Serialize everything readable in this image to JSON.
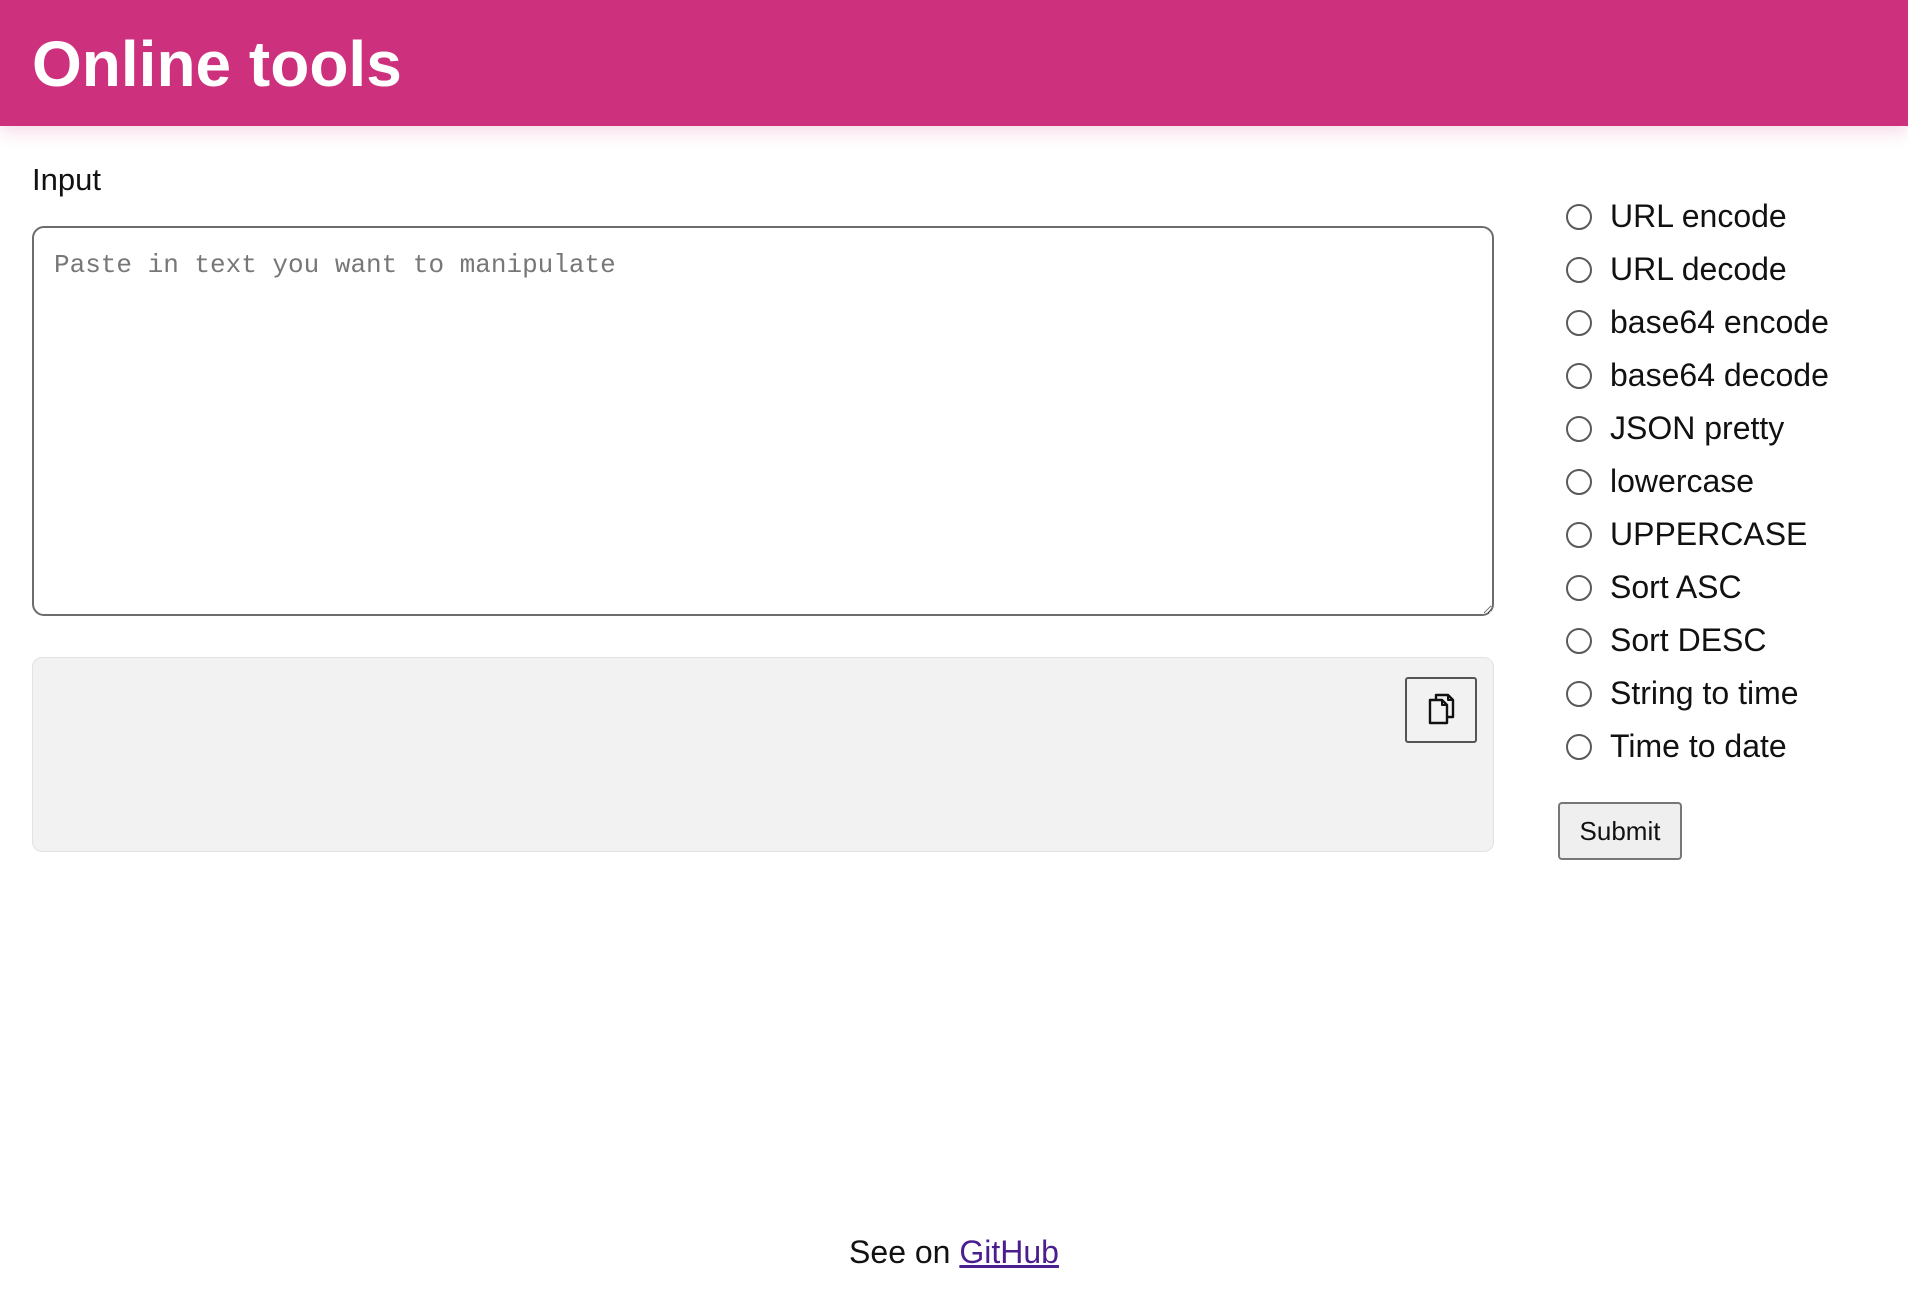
{
  "header": {
    "title": "Online tools",
    "background_color": "#cd317d"
  },
  "input": {
    "label": "Input",
    "placeholder": "Paste in text you want to manipulate",
    "value": ""
  },
  "output": {
    "value": "",
    "copy_icon": "copy-icon"
  },
  "operations": {
    "options": [
      {
        "label": "URL encode",
        "selected": false
      },
      {
        "label": "URL decode",
        "selected": false
      },
      {
        "label": "base64 encode",
        "selected": false
      },
      {
        "label": "base64 decode",
        "selected": false
      },
      {
        "label": "JSON pretty",
        "selected": false
      },
      {
        "label": "lowercase",
        "selected": false
      },
      {
        "label": "UPPERCASE",
        "selected": false
      },
      {
        "label": "Sort ASC",
        "selected": false
      },
      {
        "label": "Sort DESC",
        "selected": false
      },
      {
        "label": "String to time",
        "selected": false
      },
      {
        "label": "Time to date",
        "selected": false
      }
    ],
    "submit_label": "Submit"
  },
  "footer": {
    "prefix": "See on ",
    "link_text": "GitHub",
    "link_color": "#4a1e8e"
  }
}
